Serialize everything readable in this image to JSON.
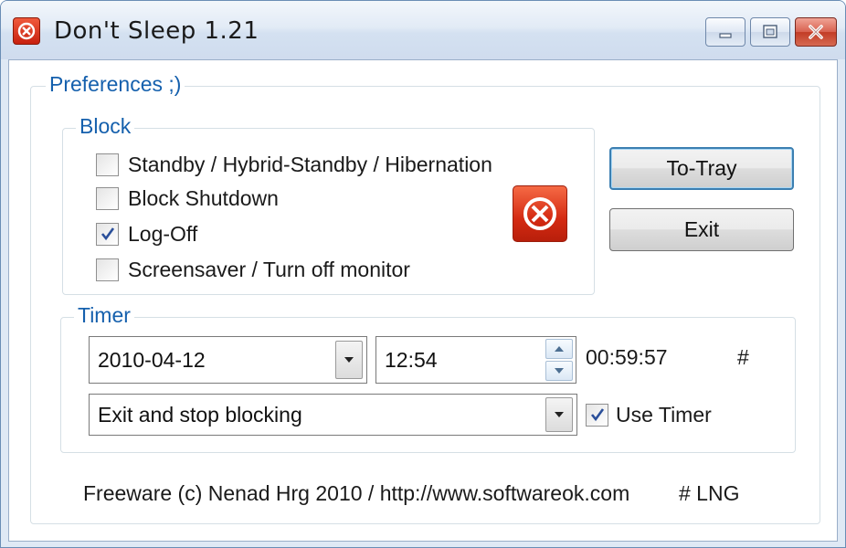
{
  "window": {
    "title": "Don't Sleep 1.21",
    "icons": {
      "app": "stop-circle-icon",
      "minimize": "minimize-icon",
      "maximize": "maximize-icon",
      "close": "close-icon"
    }
  },
  "preferences": {
    "legend": "Preferences ;)",
    "block": {
      "legend": "Block",
      "items": [
        {
          "label": "Standby / Hybrid-Standby / Hibernation",
          "checked": false
        },
        {
          "label": "Block Shutdown",
          "checked": false
        },
        {
          "label": "Log-Off",
          "checked": true
        },
        {
          "label": "Screensaver / Turn off monitor",
          "checked": false
        }
      ],
      "status_icon": "stop-circle-icon"
    },
    "buttons": {
      "to_tray": "To-Tray",
      "exit": "Exit"
    },
    "timer": {
      "legend": "Timer",
      "date": "2010-04-12",
      "time": "12:54",
      "countdown": "00:59:57",
      "hash": "#",
      "action": "Exit and stop blocking",
      "use_timer_label": "Use Timer",
      "use_timer_checked": true
    }
  },
  "footer": {
    "copyright": "Freeware (c) Nenad Hrg 2010 / http://www.softwareok.com",
    "lng": "# LNG"
  },
  "colors": {
    "accent_text": "#1560ad",
    "icon_red": "#d42a12"
  }
}
